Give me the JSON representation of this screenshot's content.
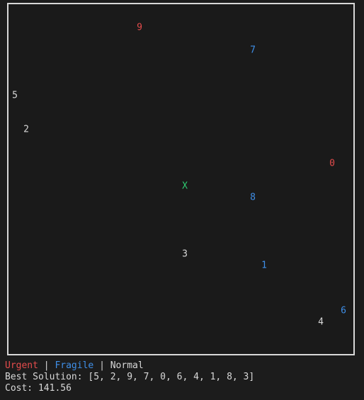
{
  "colors": {
    "background": "#1c1c1c",
    "frame": "#d8d8d8",
    "urgent": "#e44c4c",
    "fragile": "#3f8fe8",
    "normal": "#d8d8d8",
    "depot": "#2ecc71"
  },
  "depot": {
    "label": "X"
  },
  "nodes": [
    {
      "label": "0",
      "kind": "urgent"
    },
    {
      "label": "1",
      "kind": "fragile"
    },
    {
      "label": "2",
      "kind": "normal"
    },
    {
      "label": "3",
      "kind": "normal"
    },
    {
      "label": "4",
      "kind": "normal"
    },
    {
      "label": "5",
      "kind": "normal"
    },
    {
      "label": "6",
      "kind": "fragile"
    },
    {
      "label": "7",
      "kind": "fragile"
    },
    {
      "label": "8",
      "kind": "fragile"
    },
    {
      "label": "9",
      "kind": "urgent"
    }
  ],
  "legend": {
    "urgent": "Urgent",
    "separator": " | ",
    "fragile": "Fragile",
    "normal": "Normal"
  },
  "solution": {
    "label": "Best Solution: ",
    "value": "[5, 2, 9, 7, 0, 6, 4, 1, 8, 3]"
  },
  "cost": {
    "label": "Cost: ",
    "value": "141.56"
  }
}
